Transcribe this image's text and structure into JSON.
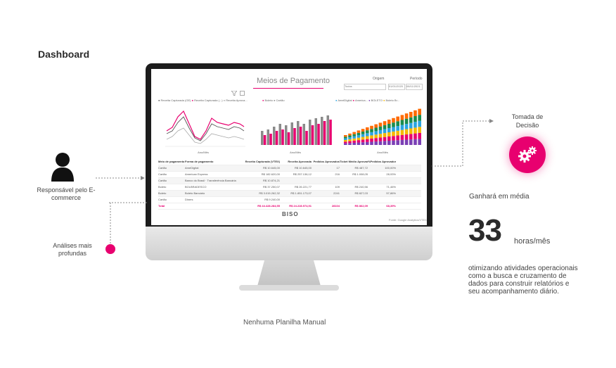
{
  "page": {
    "title": "Dashboard",
    "monitor_caption": "Nenhuma Planilha Manual"
  },
  "left": {
    "responsible_label": "Responsável pelo E-commerce",
    "analyses_label": "Análises mais profundas"
  },
  "right": {
    "decision_label": "Tomada de Decisão",
    "gain_label": "Ganhará em média",
    "gain_value": "33",
    "gain_unit": "horas/mês",
    "description": "otimizando atividades operacionais como a busca e cruzamento de dados para construir relatórios e seu acompanhamento diário."
  },
  "colors": {
    "accent": "#e8006f",
    "dark": "#2b2b2b"
  },
  "dashboard": {
    "title": "Meios de Pagamento",
    "origem_label": "Origem",
    "periodo_label": "Período",
    "origem_value": "Todos",
    "periodo_from": "01/01/2020",
    "periodo_to": "08/11/2021",
    "filter_icon": "funnel-icon",
    "expand_icon": "expand-icon",
    "chart1_legend": [
      "Receita Capturada (GE)",
      "Receita Capturada (...)",
      "Receita Aprova..."
    ],
    "chart1_ylabel": "Receita Capturada (GE)",
    "chart2_legend": [
      "Boleto",
      "Cartão"
    ],
    "chart2_ylabel": "%Aprovados",
    "chart3_legend": [
      "AmelDigital",
      "America...",
      "BOLETO",
      "Boleto Br...",
      "Cartao Cr..."
    ],
    "chart3_ylabel": "%Pedidos Aprovados",
    "xlabel": "Ano/Mês",
    "table": {
      "headers": [
        "Meio de pagamento",
        "Forma de pagamento",
        "Receita Capturada (VTEX)",
        "Receita Aprovada",
        "Pedidos Aprovados",
        "Ticket Médio Aprovado",
        "%Pedidos Aprovados"
      ],
      "rows": [
        [
          "Cartão",
          "AmeDigital",
          "R$ 10.645,00",
          "R$ 10.645,00",
          "17",
          "R$ 487,72",
          "100,00%"
        ],
        [
          "Cartão",
          "American Express",
          "R$ 182.620,00",
          "R$ 257.136,12",
          "216",
          "R$ 1.008,05",
          "28,93%"
        ],
        [
          "Cartão",
          "Banco do Brasil · Transferência Bancária",
          "R$ 10.874,21",
          "",
          "",
          "",
          ""
        ],
        [
          "Boleto",
          "BOLBRADESCO",
          "R$ 37.250,07",
          "R$ 26.221,77",
          "109",
          "R$ 240,56",
          "71,46%"
        ],
        [
          "Boleto",
          "Boleto Bancário",
          "R$ 3.015.262,32",
          "R$ 1.851.173,07",
          "2241",
          "R$ 827,03",
          "57,86%"
        ],
        [
          "Cartão",
          "Diners",
          "R$ 9.240,00",
          "",
          "",
          "",
          ""
        ]
      ],
      "total": [
        "Total",
        "",
        "R$ 44.428.284,55",
        "R$ 24.228.974,91",
        "28104",
        "R$ 862,09",
        "68,39%"
      ]
    },
    "logo": "BISO",
    "source": "Fonte: Google Analytics/VTEX"
  }
}
